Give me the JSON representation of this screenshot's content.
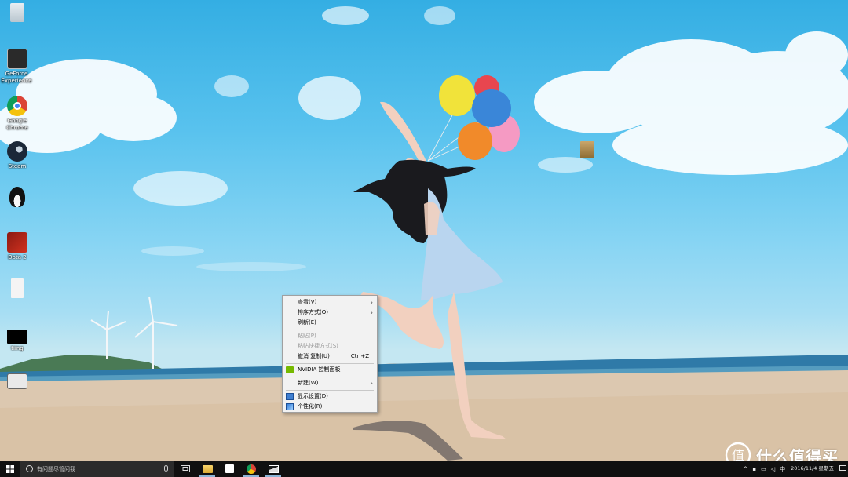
{
  "desktop": {
    "icons": [
      {
        "label": "GeForce Experience",
        "icon": "geforce-icon"
      },
      {
        "label": "Google Chrome",
        "icon": "chrome-icon"
      },
      {
        "label": "Steam",
        "icon": "steam-icon"
      },
      {
        "label": "Dota 2",
        "icon": "dota2-icon"
      },
      {
        "label": "tiing",
        "icon": "tiing-icon"
      }
    ],
    "colors": {
      "accent_menu_bg": "#f2f2f2",
      "taskbar_bg": "#101010"
    }
  },
  "context_menu": {
    "items": [
      {
        "label": "查看(V)",
        "submenu": true,
        "enabled": true
      },
      {
        "label": "排序方式(O)",
        "submenu": true,
        "enabled": true
      },
      {
        "label": "刷新(E)",
        "enabled": true
      },
      {
        "label": "粘贴(P)",
        "enabled": false
      },
      {
        "label": "粘贴快捷方式(S)",
        "enabled": false
      },
      {
        "label": "撤消 复制(U)",
        "accel": "Ctrl+Z",
        "enabled": true
      },
      {
        "label": "NVIDIA 控制面板",
        "icon": "nvidia-icon",
        "enabled": true
      },
      {
        "label": "新建(W)",
        "submenu": true,
        "enabled": true
      },
      {
        "label": "显示设置(D)",
        "icon": "display-icon",
        "enabled": true
      },
      {
        "label": "个性化(R)",
        "icon": "personalize-icon",
        "enabled": true
      }
    ],
    "arrow": "›"
  },
  "taskbar": {
    "search_placeholder": "有问题尽管问我",
    "pinned": [
      "file-explorer-icon",
      "store-icon",
      "chrome-icon",
      "photos-icon"
    ],
    "tray": {
      "ime": "中",
      "date": "2016/11/4 星期五"
    }
  },
  "watermark": {
    "text": "什么值得买",
    "logo_char": "值"
  }
}
